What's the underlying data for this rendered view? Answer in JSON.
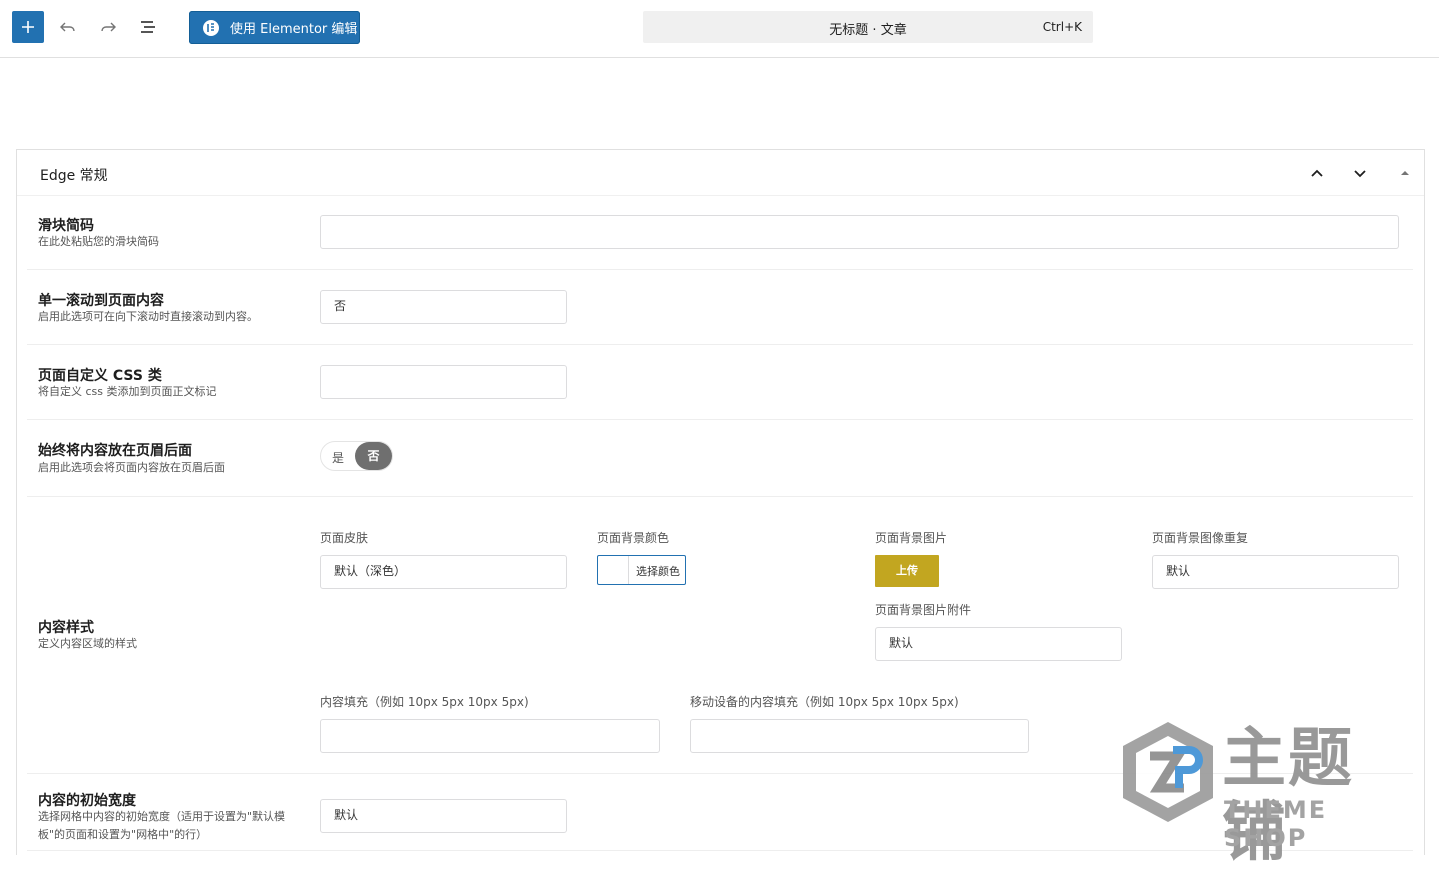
{
  "toolbar": {
    "elementor_label": "使用 Elementor 编辑",
    "doc_title": "无标题 · 文章",
    "shortcut": "Ctrl+K"
  },
  "panel": {
    "title": "Edge 常规"
  },
  "fields": {
    "slider": {
      "label": "滑块简码",
      "desc": "在此处粘贴您的滑块简码",
      "value": ""
    },
    "one_scroll": {
      "label": "单一滚动到页面内容",
      "desc": "启用此选项可在向下滚动时直接滚动到内容。",
      "value": "否"
    },
    "css_class": {
      "label": "页面自定义 CSS 类",
      "desc": "将自定义 css 类添加到页面正文标记",
      "value": ""
    },
    "behind_header": {
      "label": "始终将内容放在页眉后面",
      "desc": "启用此选项会将页面内容放在页眉后面",
      "yes": "是",
      "no": "否"
    },
    "content_style": {
      "label": "内容样式",
      "desc": "定义内容区域的样式",
      "skin_label": "页面皮肤",
      "skin_value": "默认（深色）",
      "bgcolor_label": "页面背景颜色",
      "bgcolor_button": "选择颜色",
      "bgimage_label": "页面背景图片",
      "upload_label": "上传",
      "bgrepeat_label": "页面背景图像重复",
      "bgrepeat_value": "默认",
      "attach_label": "页面背景图片附件",
      "attach_value": "默认",
      "padding_label": "内容填充（例如 10px 5px 10px 5px)",
      "padding_value": "",
      "mobile_padding_label": "移动设备的内容填充（例如 10px 5px 10px 5px)",
      "mobile_padding_value": ""
    },
    "initial_width": {
      "label": "内容的初始宽度",
      "desc": "选择网格中内容的初始宽度（适用于设置为\"默认模板\"的页面和设置为\"网格中\"的行）",
      "value": "默认"
    }
  },
  "watermark": {
    "cn": "主题铺",
    "en": "THEME SHOP"
  },
  "colors": {
    "primary": "#2271b1",
    "upload": "#c2a620",
    "toggle_active": "#6f6f6f"
  }
}
